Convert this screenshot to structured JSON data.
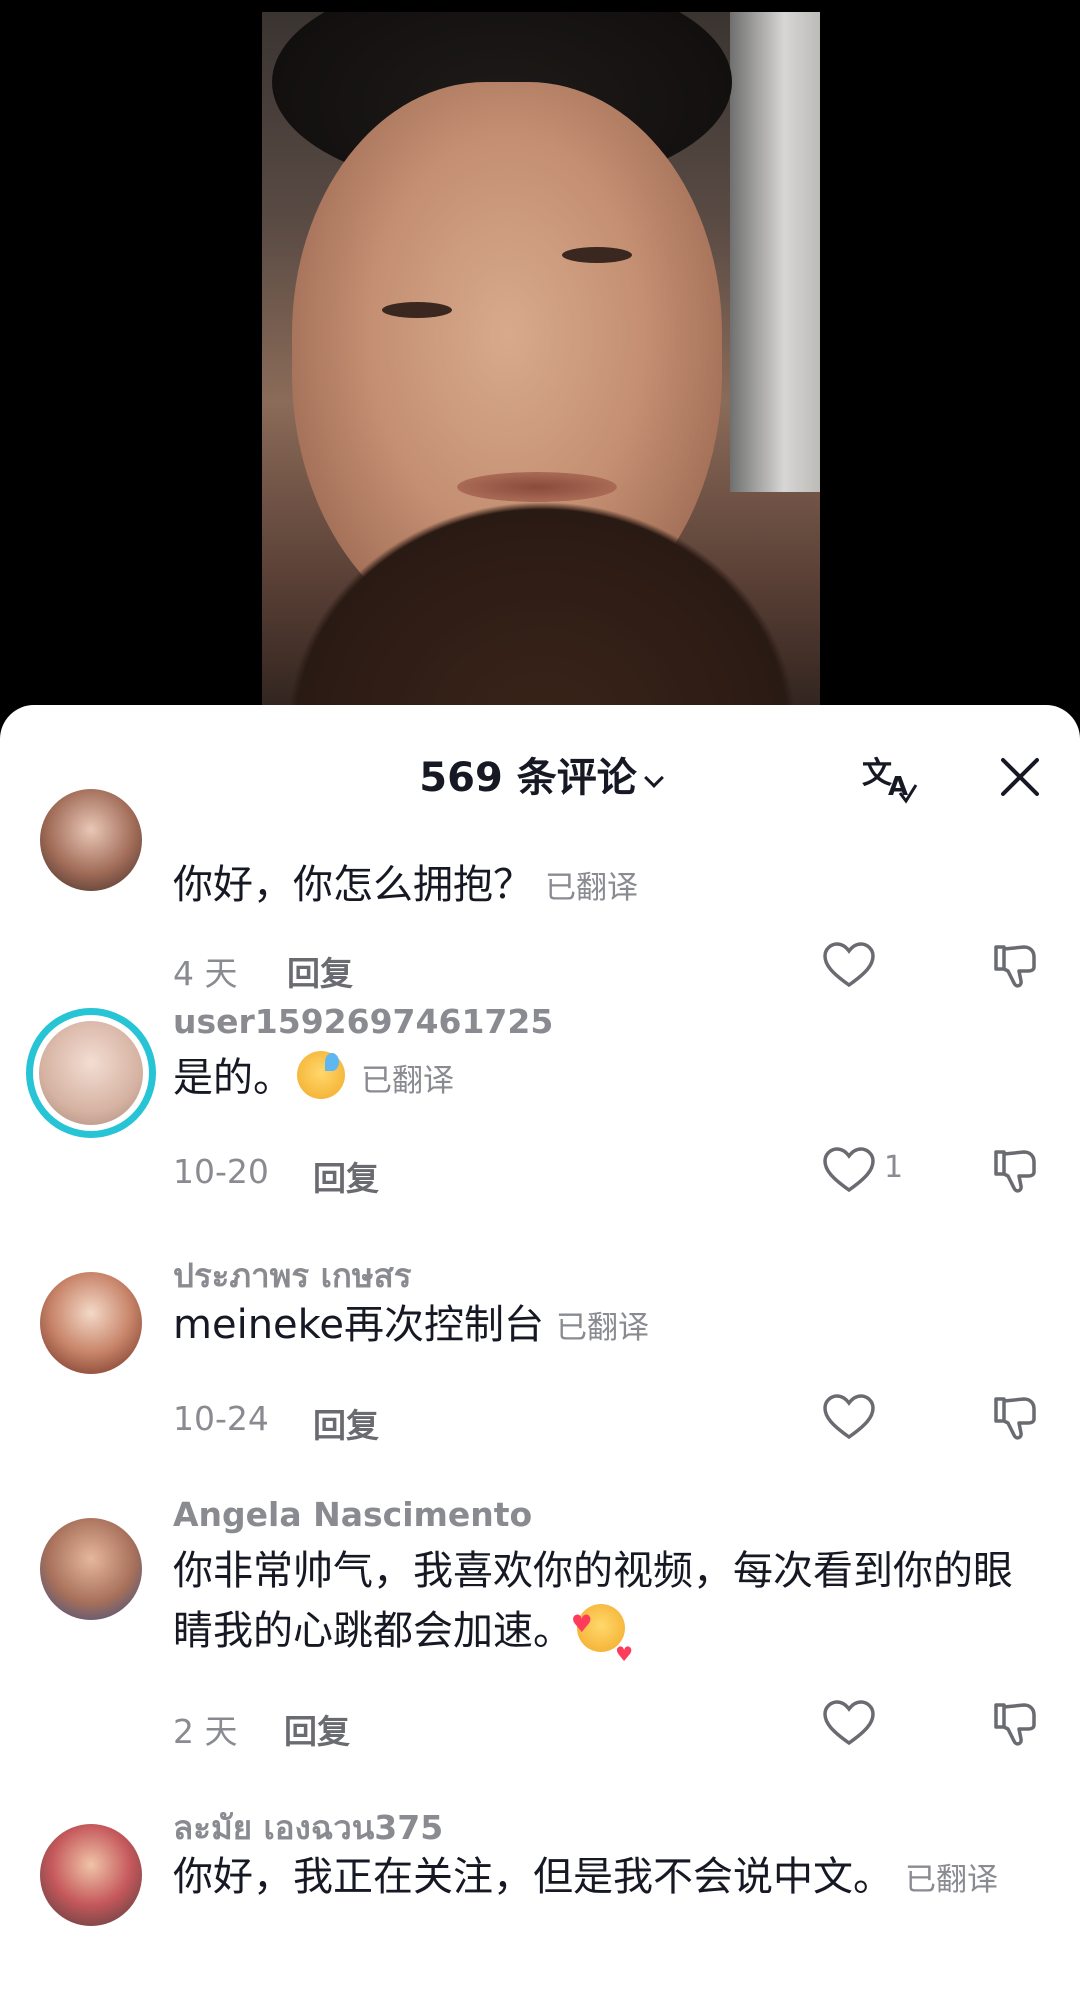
{
  "sheet": {
    "title": "569 条评论",
    "translate_icon": "translate-icon",
    "close_icon": "close-icon"
  },
  "comments": [
    {
      "username": "",
      "text": "你好，你怎么拥抱？",
      "translated_label": "已翻译",
      "date": "4 天",
      "reply": "回复",
      "likes": ""
    },
    {
      "username": "user1592697461725",
      "text": "是的。",
      "translated_label": "已翻译",
      "date": "10-20",
      "reply": "回复",
      "likes": "1"
    },
    {
      "username": "ประภาพร เกษสร",
      "text": "meineke再次控制台",
      "translated_label": "已翻译",
      "date": "10-24",
      "reply": "回复",
      "likes": ""
    },
    {
      "username": "Angela Nascimento",
      "text": "你非常帅气，我喜欢你的视频，每次看到你的眼睛我的心跳都会加速。",
      "translated_label": "",
      "date": "2 天",
      "reply": "回复",
      "likes": ""
    },
    {
      "username": "ละมัย เองฉวน375",
      "text": "你好，我正在关注，但是我不会说中文。",
      "translated_label": "已翻译",
      "date": "",
      "reply": "",
      "likes": ""
    }
  ],
  "colors": {
    "accent_ring": "#27c4d6",
    "text_primary": "#161823",
    "text_secondary": "#8a8b91"
  }
}
